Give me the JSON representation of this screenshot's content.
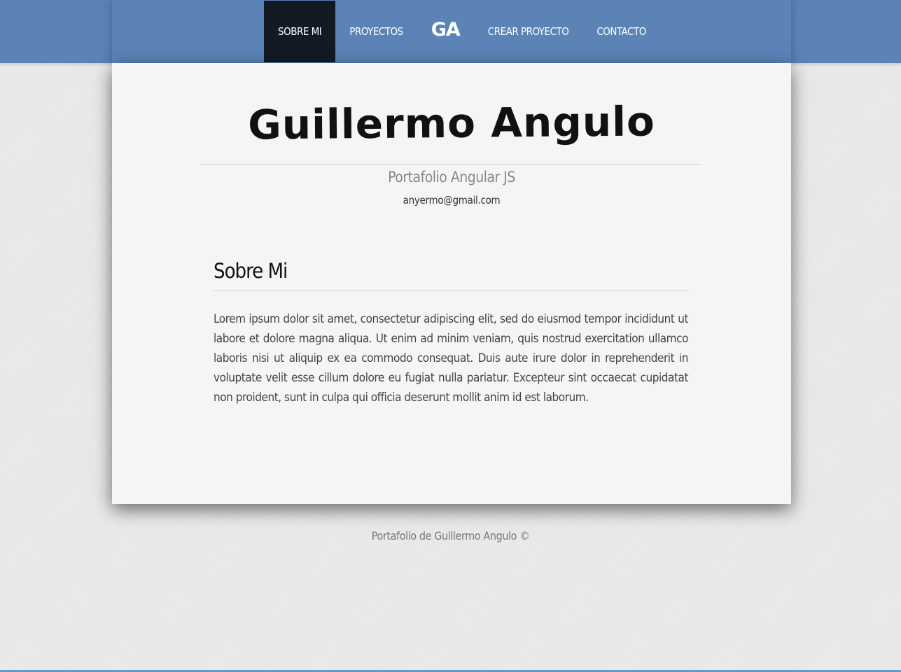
{
  "nav": {
    "items": [
      {
        "label": "SOBRE MI",
        "active": true
      },
      {
        "label": "PROYECTOS",
        "active": false
      },
      {
        "label": "GA",
        "logo": true
      },
      {
        "label": "CREAR PROYECTO",
        "active": false
      },
      {
        "label": "CONTACTO",
        "active": false
      }
    ],
    "background": "#5b83b6",
    "active_background": "#131a24"
  },
  "hero": {
    "title": "Guillermo Angulo",
    "subtitle": "Portafolio Angular JS",
    "email": "anyermo@gmail.com"
  },
  "section": {
    "heading": "Sobre Mi",
    "body": "Lorem ipsum dolor sit amet, consectetur adipiscing elit, sed do eiusmod tempor incididunt ut labore et dolore magna aliqua. Ut enim ad minim veniam, quis nostrud exercitation ullamco laboris nisi ut aliquip ex ea commodo consequat. Duis aute irure dolor in reprehenderit in voluptate velit esse cillum dolore eu fugiat nulla pariatur. Excepteur sint occaecat cupidatat non proident, sunt in culpa qui officia deserunt mollit anim id est laborum."
  },
  "footer": {
    "text": "Portafolio de Guillermo Angulo ©"
  }
}
